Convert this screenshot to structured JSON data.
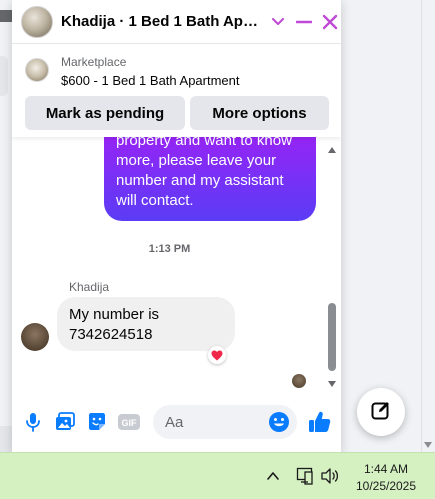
{
  "header": {
    "title": "Khadija · 1 Bed 1 Bath Apar...",
    "accent": "#c04ad6"
  },
  "listing": {
    "source": "Marketplace",
    "title": "$600 - 1 Bed 1 Bath Apartment",
    "pending_label": "Mark as pending",
    "more_label": "More options"
  },
  "messages": {
    "outgoing_text": "property and want to know\nmore, please leave your\nnumber and my assistant\nwill contact.",
    "timestamp": "1:13 PM",
    "sender_name": "Khadija",
    "incoming_text": "My number is\n7342624518",
    "reaction": "heart"
  },
  "composer": {
    "placeholder": "Aa",
    "gif_label": "GIF",
    "icons": [
      "microphone-icon",
      "photo-icon",
      "sticker-icon",
      "gif-icon",
      "emoji-icon",
      "thumbs-up-icon"
    ],
    "icon_color": "#0a7cff"
  },
  "taskbar": {
    "time": "1:44 AM",
    "date": "10/25/2025"
  }
}
